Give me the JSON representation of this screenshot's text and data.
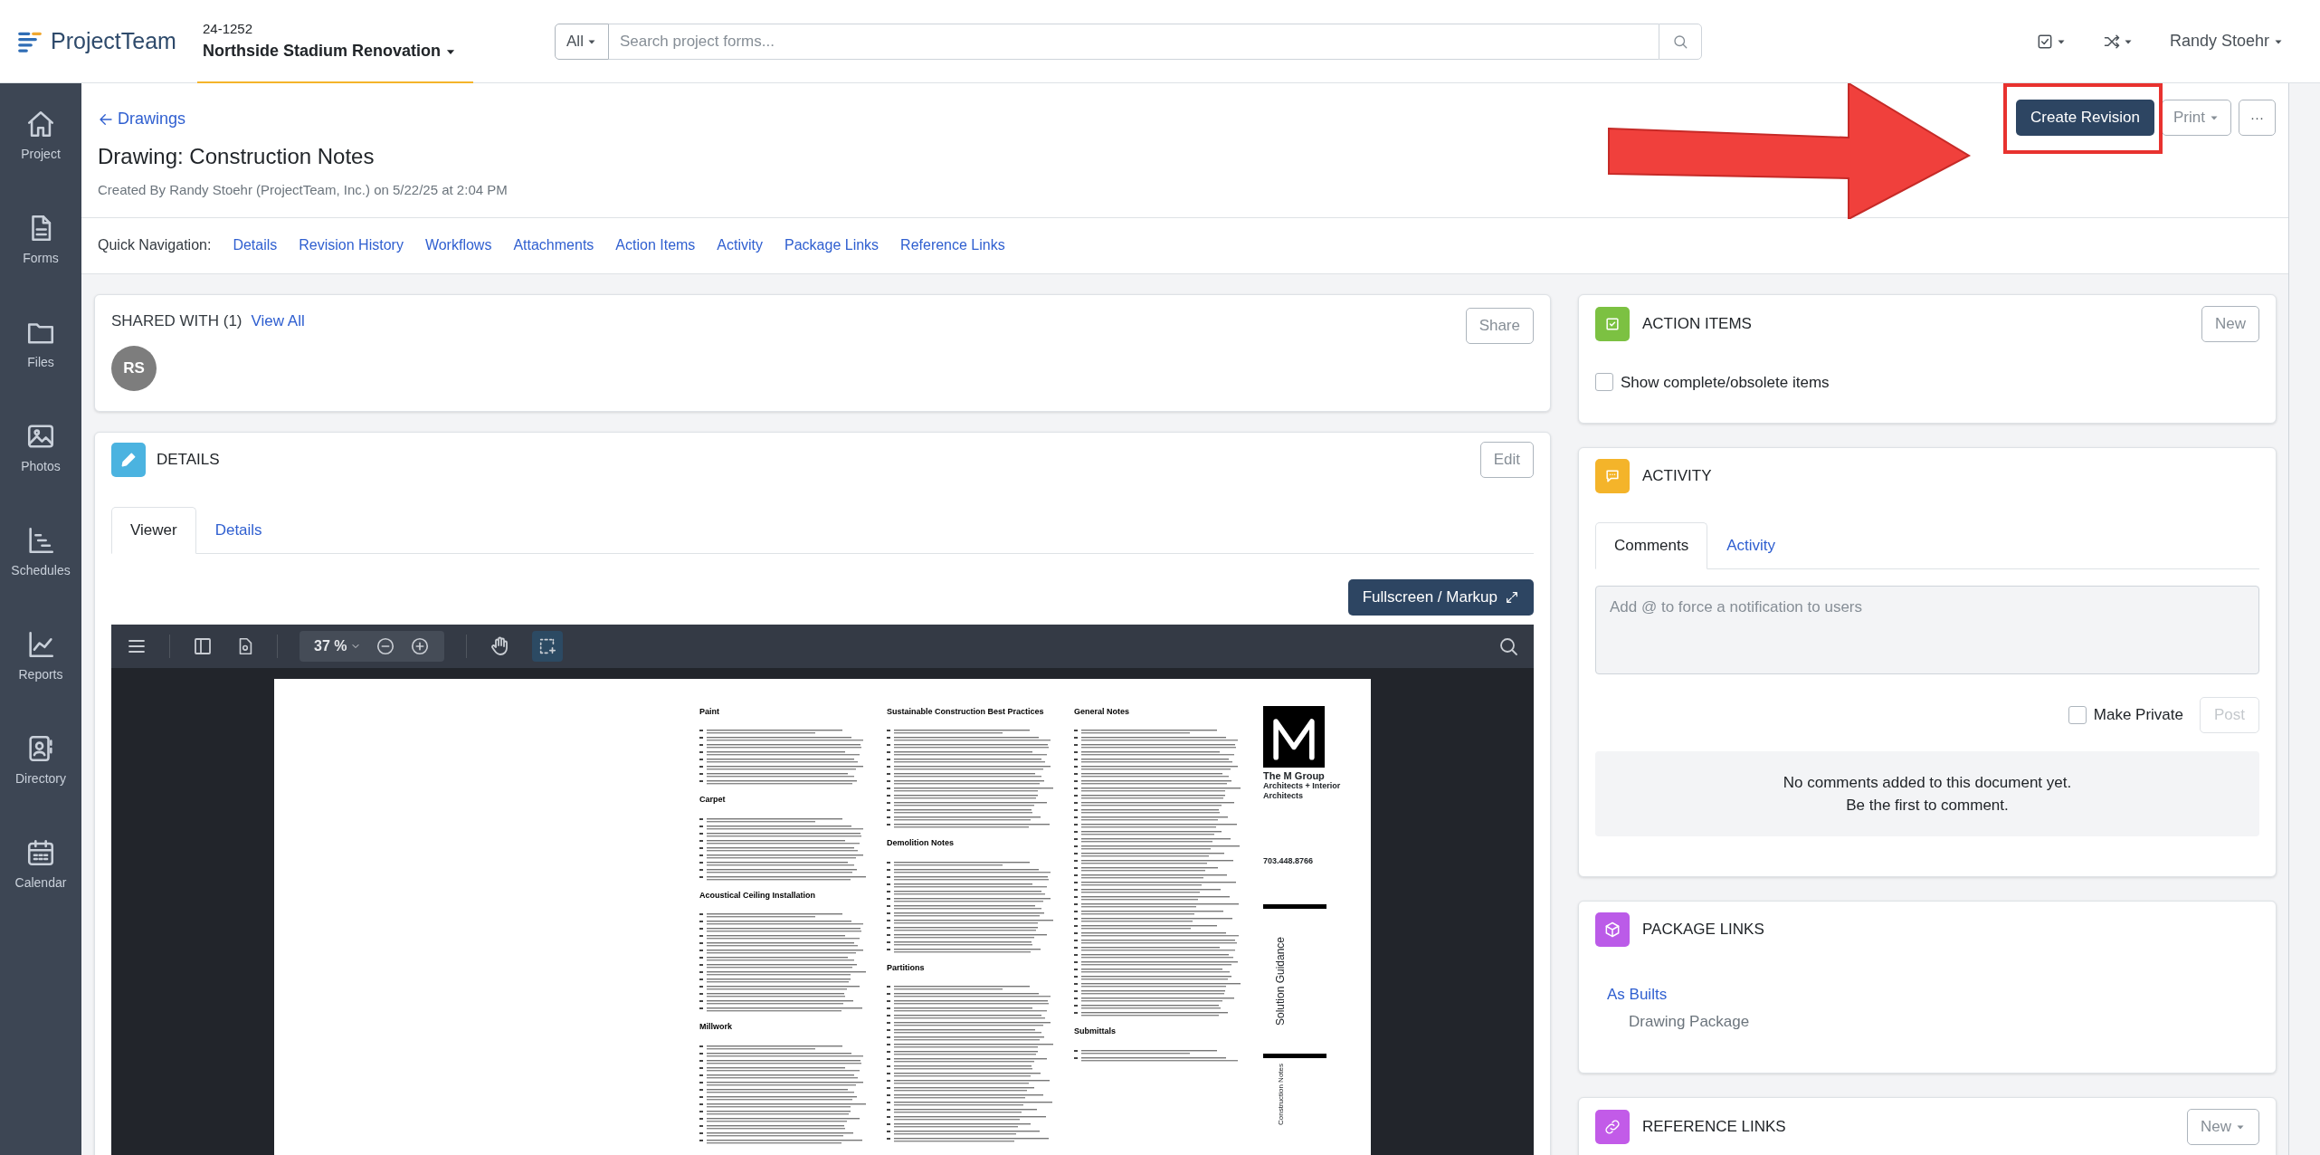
{
  "topbar": {
    "logo": "ProjectTeam",
    "project_number": "24-1252",
    "project_name": "Northside Stadium Renovation",
    "search": {
      "scope": "All",
      "placeholder": "Search project forms..."
    },
    "user": "Randy Stoehr"
  },
  "sidebar": {
    "items": [
      {
        "label": "Project"
      },
      {
        "label": "Forms"
      },
      {
        "label": "Files"
      },
      {
        "label": "Photos"
      },
      {
        "label": "Schedules"
      },
      {
        "label": "Reports"
      },
      {
        "label": "Directory"
      },
      {
        "label": "Calendar"
      }
    ]
  },
  "header": {
    "back_link": "Drawings",
    "title": "Drawing: Construction Notes",
    "created": "Created By Randy Stoehr (ProjectTeam, Inc.) on 5/22/25 at 2:04 PM",
    "buttons": [
      {
        "label": "Create Revision",
        "kind": "primary",
        "highlighted": true
      },
      {
        "label": "Print",
        "kind": "dropdown",
        "highlighted": false
      },
      {
        "label": "···",
        "kind": "plain",
        "highlighted": false
      }
    ]
  },
  "quick_navigation": {
    "label": "Quick Navigation:",
    "links": [
      "Details",
      "Revision History",
      "Workflows",
      "Attachments",
      "Action Items",
      "Activity",
      "Package Links",
      "Reference Links"
    ]
  },
  "shared_with": {
    "title": "SHARED WITH (1)",
    "view_all": "View All",
    "button": "Share",
    "avatars": [
      "RS"
    ]
  },
  "details": {
    "title": "DETAILS",
    "button": "Edit",
    "tabs": [
      {
        "label": "Viewer",
        "selected": true
      },
      {
        "label": "Details",
        "selected": false
      }
    ],
    "fullscreen": "Fullscreen / Markup",
    "viewer": {
      "zoom": "37 %",
      "document": {
        "columns": [
          {
            "sections": [
              {
                "heading": "Paint"
              },
              {
                "heading": "Carpet"
              },
              {
                "heading": "Acoustical Ceiling Installation"
              },
              {
                "heading": "Millwork"
              }
            ]
          },
          {
            "sections": [
              {
                "heading": "Sustainable Construction Best Practices"
              },
              {
                "heading": "Demolition Notes"
              },
              {
                "heading": "Partitions"
              }
            ]
          },
          {
            "sections": [
              {
                "heading": "General Notes"
              },
              {
                "heading": "Submittals"
              }
            ]
          }
        ],
        "firm": "The M Group",
        "firm_tagline": "Architects + Interior Architects",
        "phone": "703.448.8766",
        "project_label": "Solution Guidance",
        "sheet_title": "Construction Notes"
      }
    }
  },
  "action_items": {
    "title": "ACTION ITEMS",
    "button": "New",
    "checkbox": {
      "label": "Show complete/obsolete items",
      "checked": false
    }
  },
  "activity": {
    "title": "ACTIVITY",
    "tabs": [
      {
        "label": "Comments",
        "selected": true
      },
      {
        "label": "Activity",
        "selected": false
      }
    ],
    "comment": {
      "placeholder": "Add @ to force a notification to users"
    },
    "private": {
      "label": "Make Private",
      "checked": false
    },
    "post": {
      "label": "Post",
      "disabled": true
    },
    "empty": [
      "No comments added to this document yet.",
      "Be the first to comment."
    ]
  },
  "package_links": {
    "title": "PACKAGE LINKS",
    "items": [
      {
        "link": "As Builts",
        "type": "Drawing Package"
      }
    ]
  },
  "reference_links": {
    "title": "REFERENCE LINKS",
    "button": "New"
  }
}
